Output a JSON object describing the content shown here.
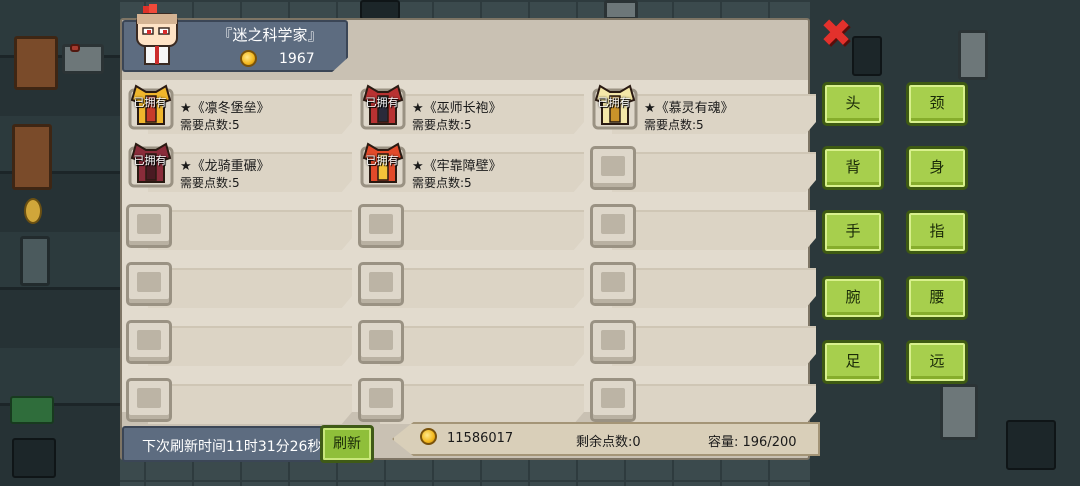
{
  "profile": {
    "name": "『迷之科学家』",
    "coins": "1967"
  },
  "owned_label": "已拥有",
  "items": [
    [
      {
        "name": "★《凛冬堡垒》",
        "points": "需要点数:5",
        "owned": true,
        "icon": "winter-fortress-armor-icon"
      },
      {
        "name": "★《巫师长袍》",
        "points": "需要点数:5",
        "owned": true,
        "icon": "wizard-robe-icon"
      },
      {
        "name": "★《慕灵有魂》",
        "points": "需要点数:5",
        "owned": true,
        "icon": "spirit-armor-icon"
      }
    ],
    [
      {
        "name": "★《龙骑重碾》",
        "points": "需要点数:5",
        "owned": true,
        "icon": "dragon-knight-armor-icon"
      },
      {
        "name": "★《牢靠障壁》",
        "points": "需要点数:5",
        "owned": true,
        "icon": "barrier-armor-icon"
      },
      null
    ],
    [
      null,
      null,
      null
    ],
    [
      null,
      null,
      null
    ],
    [
      null,
      null,
      null
    ],
    [
      null,
      null,
      null
    ]
  ],
  "footer": {
    "timer": "下次刷新时间11时31分26秒",
    "refresh_label": "刷新",
    "gold": "11586017",
    "remaining_points": "剩余点数:0",
    "capacity": "容量:  196/200"
  },
  "close_icon": "close-x-icon",
  "filters": [
    {
      "label": "头"
    },
    {
      "label": "颈"
    },
    {
      "label": "背"
    },
    {
      "label": "身"
    },
    {
      "label": "手"
    },
    {
      "label": "指"
    },
    {
      "label": "腕"
    },
    {
      "label": "腰"
    },
    {
      "label": "足"
    },
    {
      "label": "远"
    }
  ],
  "colors": {
    "panel": "#c9c1b3",
    "button_green": "#a7cf4d",
    "profile_blue": "#5d6c80",
    "close_red": "#e3312c"
  }
}
